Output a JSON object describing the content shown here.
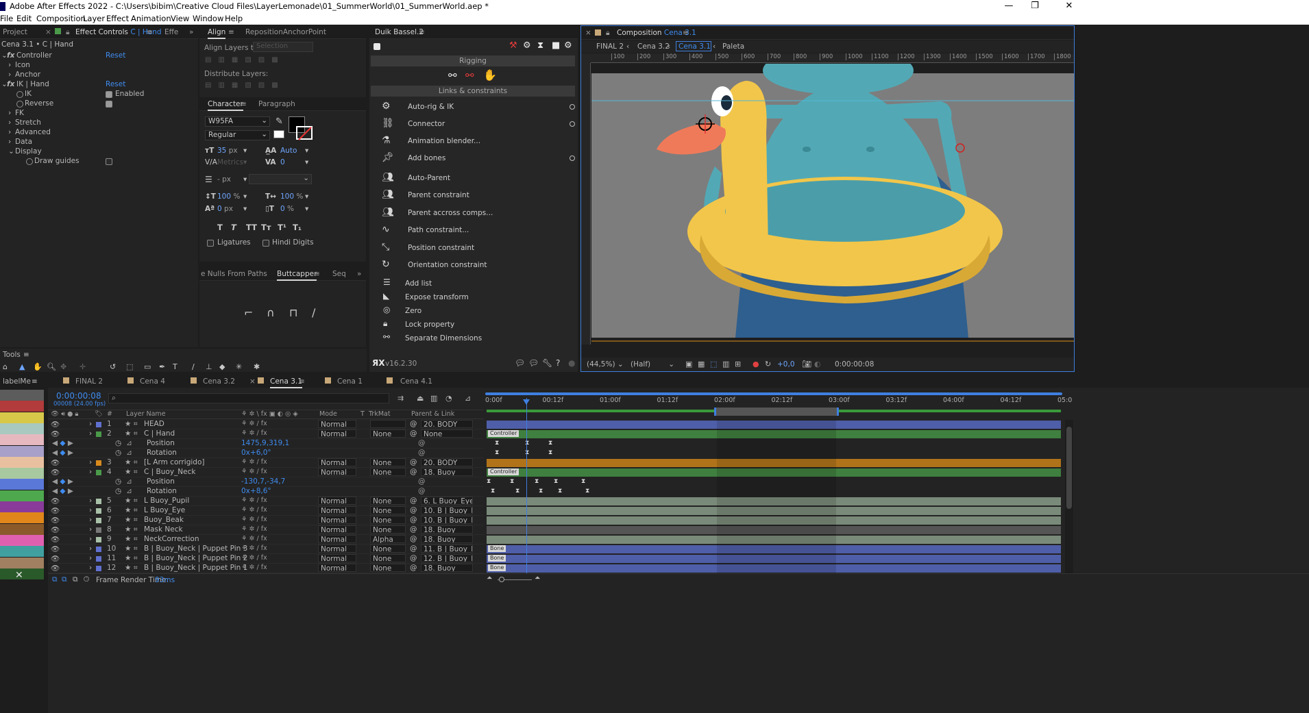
{
  "window": {
    "title": "Adobe After Effects 2022 - C:\\Users\\bibim\\Creative Cloud Files\\LayerLemonade\\01_SummerWorld\\01_SummerWorld.aep *",
    "minimize": "—",
    "restore": "❐",
    "close": "✕"
  },
  "menu": [
    "File",
    "Edit",
    "Composition",
    "Layer",
    "Effect",
    "Animation",
    "View",
    "Window",
    "Help"
  ],
  "effect_controls": {
    "tab_project": "Project",
    "tab_label": "Effect Controls",
    "tab_target": "C | Hand",
    "tab_effe": "Effe",
    "path": "Cena 3.1 • C | Hand",
    "controller": "Controller",
    "reset": "Reset",
    "icon": "Icon",
    "anchor": "Anchor",
    "ik_hand": "IK | Hand",
    "ik": "IK",
    "enabled": "Enabled",
    "reverse": "Reverse",
    "fk": "FK",
    "stretch": "Stretch",
    "advanced": "Advanced",
    "data": "Data",
    "display": "Display",
    "draw_guides": "Draw guides"
  },
  "align": {
    "tab_align": "Align",
    "tab_reposition": "RepositionAnchorPoint",
    "align_layers_to": "Align Layers to:",
    "selection": "Selection",
    "distribute": "Distribute Layers:"
  },
  "character": {
    "tab": "Character",
    "tab_paragraph": "Paragraph",
    "font": "W95FA",
    "style": "Regular",
    "size": "35",
    "size_unit": "px",
    "leading": "Auto",
    "kerning": "Metrics",
    "tracking": "0",
    "stroke_unit": "- px",
    "vscale": "100",
    "hscale": "100",
    "pct": "%",
    "baseline": "0",
    "baseline_unit": "px",
    "tsume": "0",
    "tsume_unit": "%",
    "ligatures": "Ligatures",
    "hindi": "Hindi Digits",
    "glyph_buttons": [
      "T",
      "T",
      "TT",
      "Tт",
      "T¹",
      "T₁"
    ]
  },
  "buttcapper": {
    "tab_nulls": "e Nulls From Paths",
    "tab": "Buttcapper",
    "tab_seq": "Seq"
  },
  "duik": {
    "title": "Duik Bassel.2",
    "section_rigging": "Rigging",
    "section_links": "Links & constraints",
    "items": [
      "Auto-rig & IK",
      "Connector",
      "Animation blender...",
      "Add bones",
      "Auto-Parent",
      "Parent constraint",
      "Parent accross comps...",
      "Path constraint...",
      "Position constraint",
      "Orientation constraint"
    ],
    "items2": [
      "Add list",
      "Expose transform",
      "Zero",
      "Lock property",
      "Separate Dimensions"
    ],
    "version": "v16.2.30"
  },
  "composition": {
    "tab_label": "Composition",
    "tab_name": "Cena 3.1",
    "breadcrumbs": [
      "FINAL 2",
      "Cena 3.2",
      "Cena 3.1",
      "Paleta"
    ],
    "ruler": [
      "100",
      "200",
      "300",
      "400",
      "500",
      "600",
      "700",
      "800",
      "900",
      "1000",
      "1100",
      "1200",
      "1300",
      "1400",
      "1500",
      "1600",
      "1700",
      "1800"
    ],
    "zoom": "(44,5%)",
    "resolution": "(Half)",
    "exposure": "+0,0",
    "timecode": "0:00:00:08"
  },
  "tools": {
    "label": "Tools"
  },
  "timeline": {
    "labels_tab": "labelMe",
    "tabs": [
      "FINAL 2",
      "Cena 4",
      "Cena 3.2",
      "Cena 3.1",
      "Cena 1",
      "Cena 4.1"
    ],
    "timecode": "0:00:00:08",
    "frame_info": "00008 (24.00 fps)",
    "columns": {
      "layer_name": "Layer Name",
      "mode": "Mode",
      "t": "T",
      "trkmat": "TrkMat",
      "parent": "Parent & Link"
    },
    "layers": [
      {
        "num": "1",
        "name": "HEAD",
        "mode": "Normal",
        "trk": "",
        "parent": "20. BODY",
        "color": "#6070cf"
      },
      {
        "num": "2",
        "name": "C | Hand",
        "mode": "Normal",
        "trk": "None",
        "parent": "None",
        "color": "#4a9a4a"
      },
      {
        "num": "3",
        "name": "[L Arm corrigido]",
        "mode": "Normal",
        "trk": "None",
        "parent": "20. BODY",
        "color": "#d88a1c"
      },
      {
        "num": "4",
        "name": "C | Buoy_Neck",
        "mode": "Normal",
        "trk": "None",
        "parent": "18. Buoy",
        "color": "#4a9a4a"
      },
      {
        "num": "5",
        "name": "L Buoy_Pupil",
        "mode": "Normal",
        "trk": "None",
        "parent": "6. L Buoy_Eye",
        "color": "#a8c0a8"
      },
      {
        "num": "6",
        "name": "L Buoy_Eye",
        "mode": "Normal",
        "trk": "None",
        "parent": "10. B | Buoy_I",
        "color": "#a8c0a8"
      },
      {
        "num": "7",
        "name": "Buoy_Beak",
        "mode": "Normal",
        "trk": "None",
        "parent": "10. B | Buoy_I",
        "color": "#a8c0a8"
      },
      {
        "num": "8",
        "name": "Mask Neck",
        "mode": "Normal",
        "trk": "None",
        "parent": "18. Buoy",
        "color": "#777777"
      },
      {
        "num": "9",
        "name": "NeckCorrection",
        "mode": "Normal",
        "trk": "Alpha",
        "parent": "18. Buoy",
        "color": "#a8c0a8"
      },
      {
        "num": "10",
        "name": "B | Buoy_Neck | Puppet Pin 3",
        "mode": "Normal",
        "trk": "None",
        "parent": "11. B | Buoy_I",
        "color": "#6070cf"
      },
      {
        "num": "11",
        "name": "B | Buoy_Neck | Puppet Pin 2",
        "mode": "Normal",
        "trk": "None",
        "parent": "12. B | Buoy_I",
        "color": "#6070cf"
      },
      {
        "num": "12",
        "name": "B | Buoy_Neck | Puppet Pin 1",
        "mode": "Normal",
        "trk": "None",
        "parent": "18. Buoy",
        "color": "#6070cf"
      }
    ],
    "props": {
      "position": "Position",
      "rotation": "Rotation",
      "hand_pos": "1475,9,319,1",
      "hand_rot": "0x+6,0°",
      "neck_pos": "-130,7,-34,7",
      "neck_rot": "0x+8,6°"
    },
    "bar_labels": {
      "controller": "Controller",
      "bone": "Bone"
    },
    "time_ruler": [
      "0:00f",
      "00:12f",
      "01:00f",
      "01:12f",
      "02:00f",
      "02:12f",
      "03:00f",
      "03:12f",
      "04:00f",
      "04:12f",
      "05:0"
    ],
    "render_time_label": "Frame Render Time:",
    "render_time": "93ms"
  },
  "label_colors": [
    "#5c5c5c",
    "#b23b3b",
    "#d8c84a",
    "#a8c8c0",
    "#e6b8c0",
    "#a8a0c8",
    "#e8c0a0",
    "#a8c8a0",
    "#5a78d8",
    "#4ea84e",
    "#8a3a9a",
    "#e0861a",
    "#8a5a2a",
    "#e060b0",
    "#40a0a0",
    "#a08060",
    "#2a5a2a"
  ]
}
